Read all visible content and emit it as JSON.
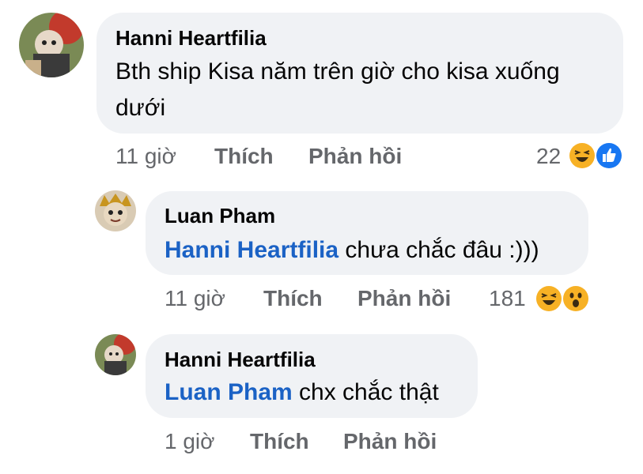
{
  "comments": [
    {
      "author": "Hanni Heartfilia",
      "text_line1": "Bth ship Kisa năm trên giờ cho kisa xuống",
      "text_line2": "dưới",
      "time": "11 giờ",
      "like_label": "Thích",
      "reply_label": "Phản hồi",
      "reaction_count": "22",
      "reactions": [
        "haha-icon",
        "like-icon"
      ]
    },
    {
      "author": "Luan Pham",
      "mention": "Hanni Heartfilia",
      "text": " chưa chắc đâu :)))",
      "time": "11 giờ",
      "like_label": "Thích",
      "reply_label": "Phản hồi",
      "reaction_count": "181",
      "reactions": [
        "haha-icon",
        "wow-icon"
      ]
    },
    {
      "author": "Hanni Heartfilia",
      "mention": "Luan Pham",
      "text": " chx chắc thật",
      "time": "1 giờ",
      "like_label": "Thích",
      "reply_label": "Phản hồi"
    }
  ],
  "colors": {
    "bubble": "#f0f2f5",
    "mention": "#1b62c5",
    "meta": "#65676b",
    "like_blue": "#1877f2",
    "reaction_yellow": "#f7b125"
  }
}
